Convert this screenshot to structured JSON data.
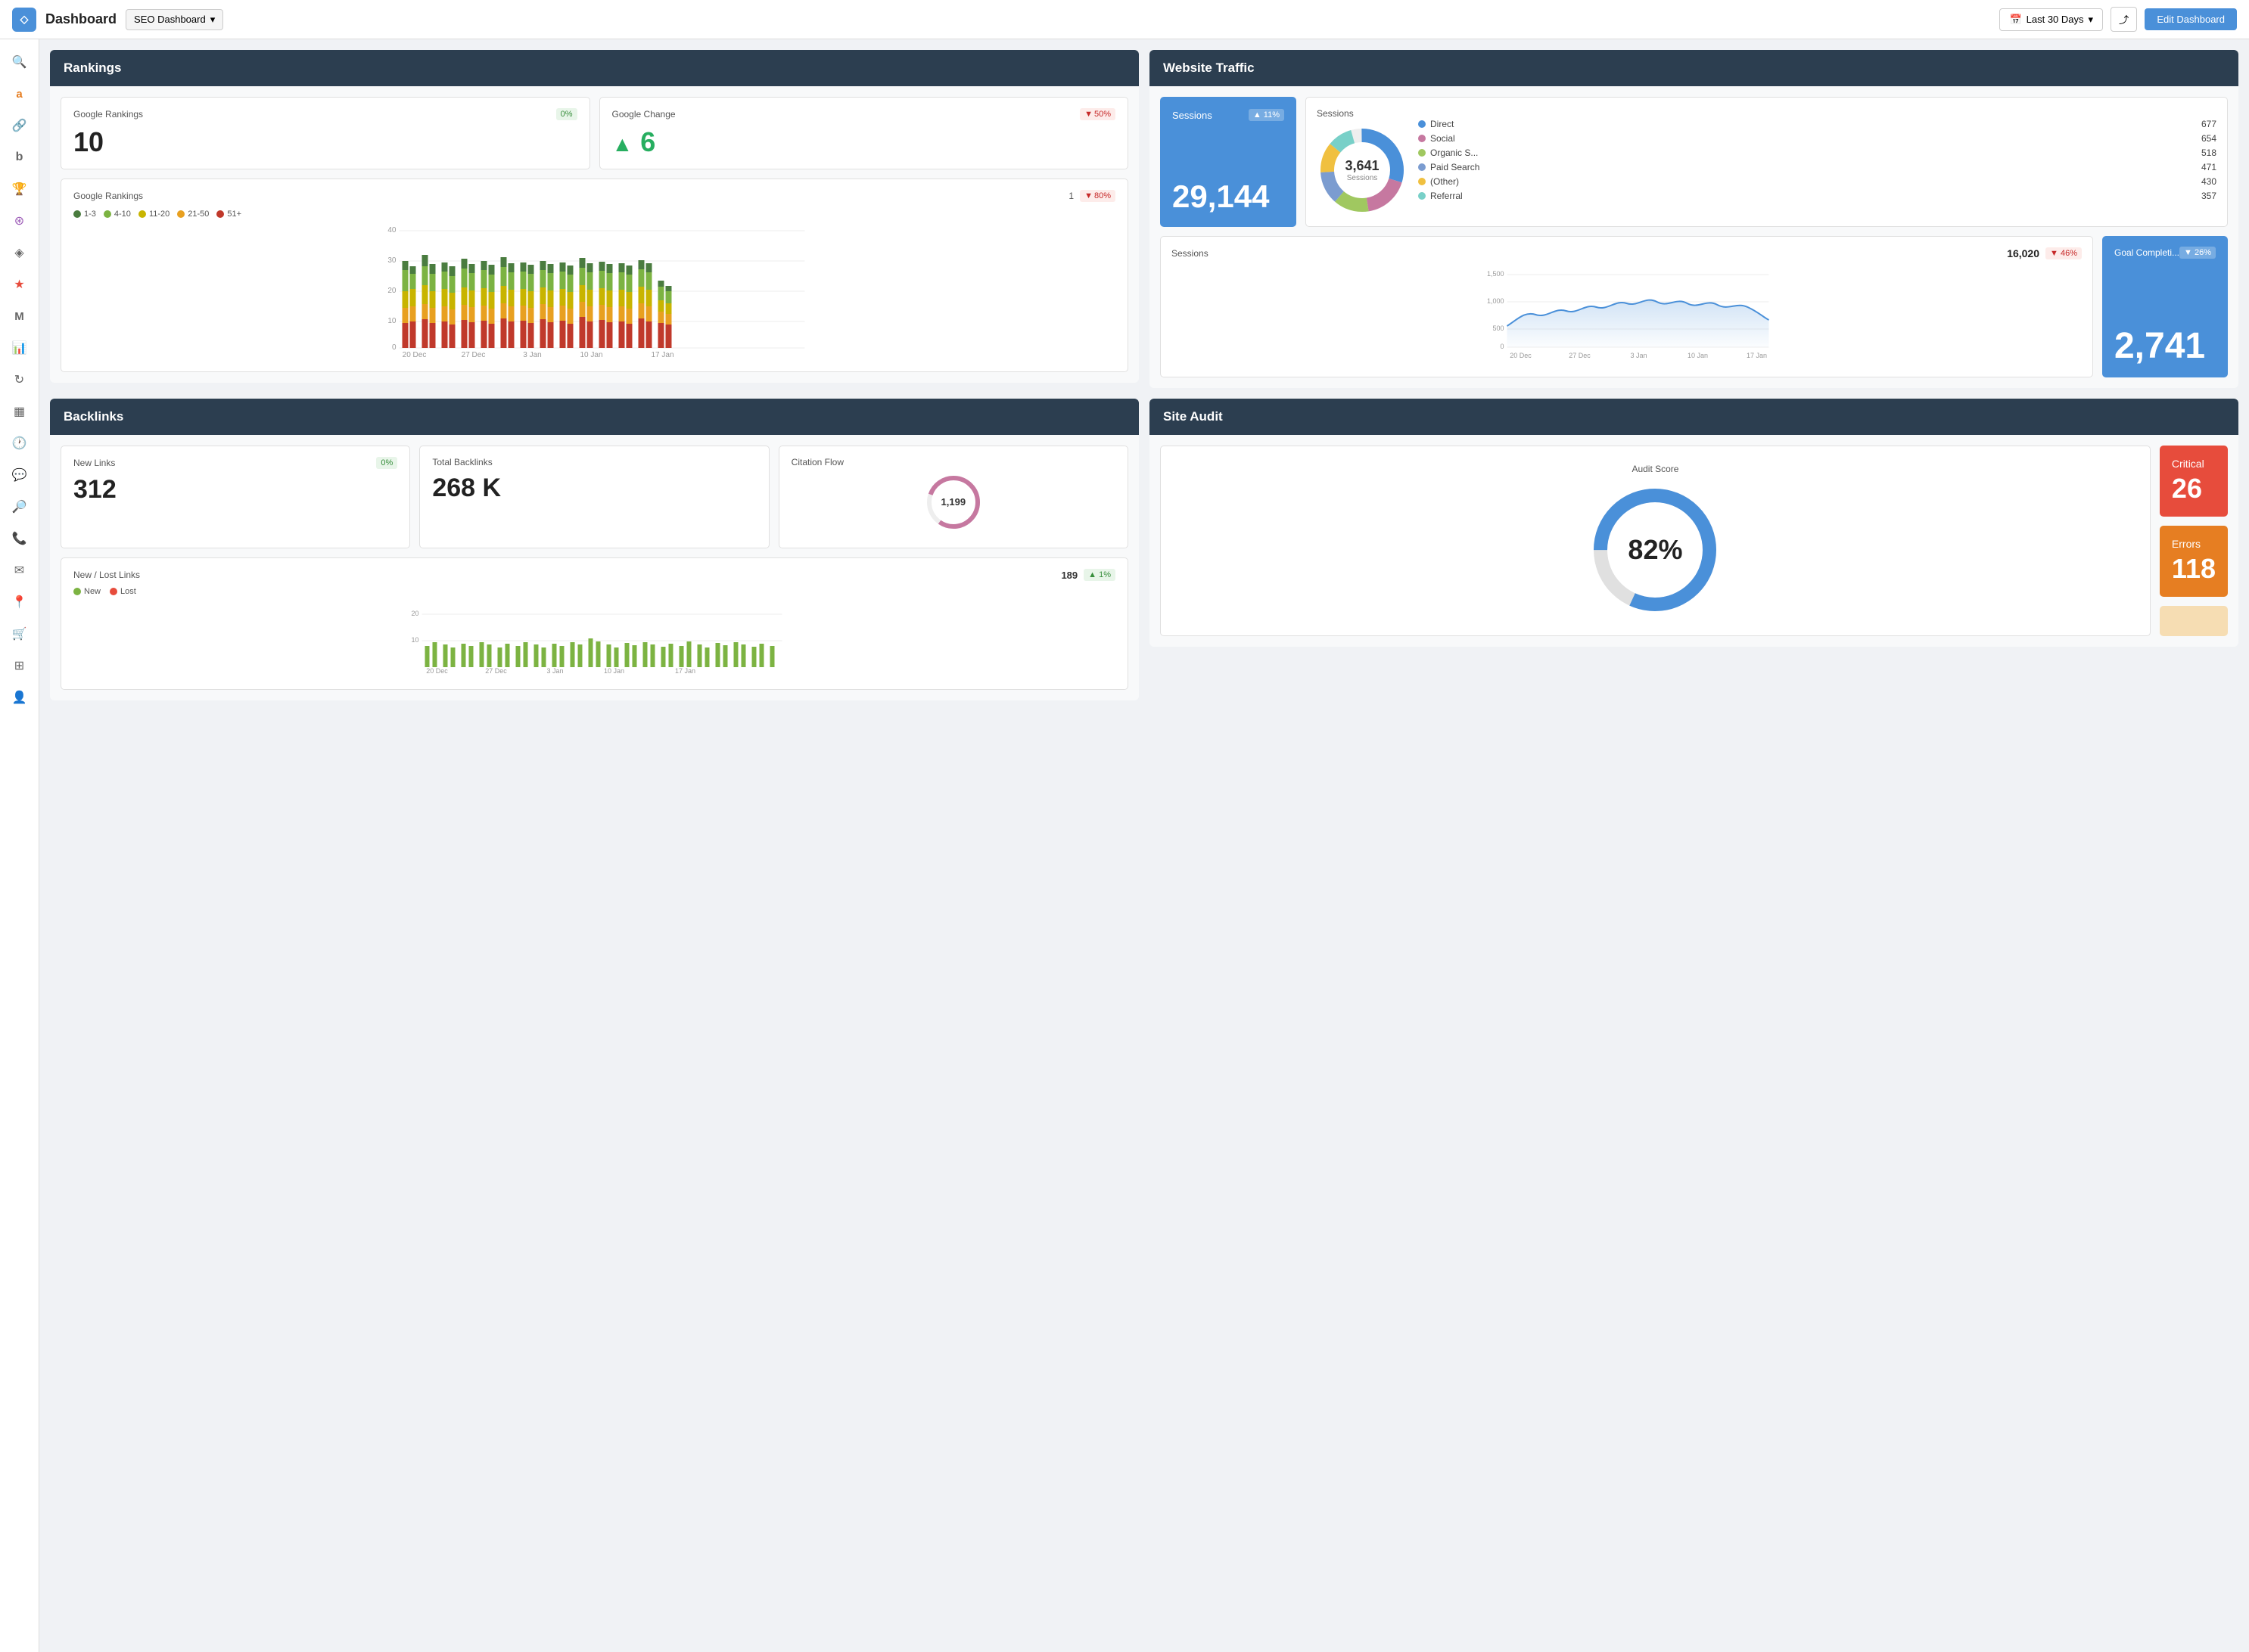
{
  "topbar": {
    "logo": "◇",
    "title": "Dashboard",
    "dashboard_name": "SEO Dashboard",
    "date_range": "Last 30 Days",
    "edit_label": "Edit Dashboard"
  },
  "sidebar": {
    "icons": [
      {
        "name": "search-icon",
        "symbol": "🔍"
      },
      {
        "name": "analytics-icon",
        "symbol": "a"
      },
      {
        "name": "link-icon",
        "symbol": "🔗"
      },
      {
        "name": "brand-icon",
        "symbol": "b"
      },
      {
        "name": "trophy-icon",
        "symbol": "🏆"
      },
      {
        "name": "settings-icon",
        "symbol": "⚙"
      },
      {
        "name": "tag-icon",
        "symbol": "◈"
      },
      {
        "name": "star-icon",
        "symbol": "★"
      },
      {
        "name": "mail-icon",
        "symbol": "M"
      },
      {
        "name": "chart-icon",
        "symbol": "📊"
      },
      {
        "name": "refresh-icon",
        "symbol": "↻"
      },
      {
        "name": "table-icon",
        "symbol": "▦"
      },
      {
        "name": "clock-icon",
        "symbol": "🕐"
      },
      {
        "name": "chat-icon",
        "symbol": "💬"
      },
      {
        "name": "search2-icon",
        "symbol": "🔎"
      },
      {
        "name": "phone-icon",
        "symbol": "📞"
      },
      {
        "name": "email-icon",
        "symbol": "✉"
      },
      {
        "name": "location-icon",
        "symbol": "📍"
      },
      {
        "name": "cart-icon",
        "symbol": "🛒"
      },
      {
        "name": "grid-icon",
        "symbol": "⊞"
      },
      {
        "name": "user-icon",
        "symbol": "👤"
      }
    ]
  },
  "rankings": {
    "section_title": "Rankings",
    "google_rankings_label": "Google Rankings",
    "google_rankings_badge": "0%",
    "google_rankings_value": "10",
    "google_change_label": "Google Change",
    "google_change_badge": "50%",
    "google_change_value": "6",
    "chart_title": "Google Rankings",
    "chart_badge_val": "1",
    "chart_badge_pct": "80%",
    "legend": [
      {
        "label": "1-3",
        "color": "#4a7c3f"
      },
      {
        "label": "4-10",
        "color": "#7cb342"
      },
      {
        "label": "11-20",
        "color": "#c8b400"
      },
      {
        "label": "21-50",
        "color": "#e8a020"
      },
      {
        "label": "51+",
        "color": "#c0392b"
      }
    ],
    "x_labels": [
      "20 Dec",
      "27 Dec",
      "3 Jan",
      "10 Jan",
      "17 Jan"
    ],
    "y_labels": [
      "40",
      "30",
      "20",
      "10",
      "0"
    ]
  },
  "website_traffic": {
    "section_title": "Website Traffic",
    "sessions_blue_label": "Sessions",
    "sessions_blue_badge": "▲ 11%",
    "sessions_blue_value": "29,144",
    "donut_label": "Sessions",
    "donut_center_value": "3,641",
    "donut_center_sub": "Sessions",
    "donut_legend": [
      {
        "label": "Direct",
        "value": "677",
        "color": "#4a90d9"
      },
      {
        "label": "Social",
        "value": "654",
        "color": "#c678a0"
      },
      {
        "label": "Organic S...",
        "value": "518",
        "color": "#a0c860"
      },
      {
        "label": "Paid Search",
        "value": "471",
        "color": "#7b9cd0"
      },
      {
        "label": "(Other)",
        "value": "430",
        "color": "#f0c040"
      },
      {
        "label": "Referral",
        "value": "357",
        "color": "#78d0c8"
      }
    ],
    "sessions_line_label": "Sessions",
    "sessions_line_value": "16,020",
    "sessions_line_badge": "▼ 46%",
    "goal_label": "Goal Completi...",
    "goal_badge": "▼ 26%",
    "goal_value": "2,741",
    "x_labels_line": [
      "20 Dec",
      "27 Dec",
      "3 Jan",
      "10 Jan",
      "17 Jan"
    ],
    "y_labels_line": [
      "1,500",
      "1,000",
      "500",
      "0"
    ]
  },
  "backlinks": {
    "section_title": "Backlinks",
    "new_links_label": "New Links",
    "new_links_badge": "0%",
    "new_links_value": "312",
    "total_backlinks_label": "Total Backlinks",
    "total_backlinks_value": "268 K",
    "citation_flow_label": "Citation Flow",
    "citation_flow_value": "1,199",
    "new_lost_label": "New / Lost Links",
    "new_lost_value": "189",
    "new_lost_badge": "▲ 1%",
    "new_legend_label": "New",
    "lost_legend_label": "Lost",
    "y_labels": [
      "20",
      "10"
    ],
    "x_labels": [
      "20 Dec",
      "27 Dec",
      "3 Jan",
      "10 Jan",
      "17 Jan"
    ]
  },
  "site_audit": {
    "section_title": "Site Audit",
    "audit_score_label": "Audit Score",
    "audit_score_value": "82%",
    "critical_label": "Critical",
    "critical_value": "26",
    "errors_label": "Errors",
    "errors_value": "118"
  }
}
